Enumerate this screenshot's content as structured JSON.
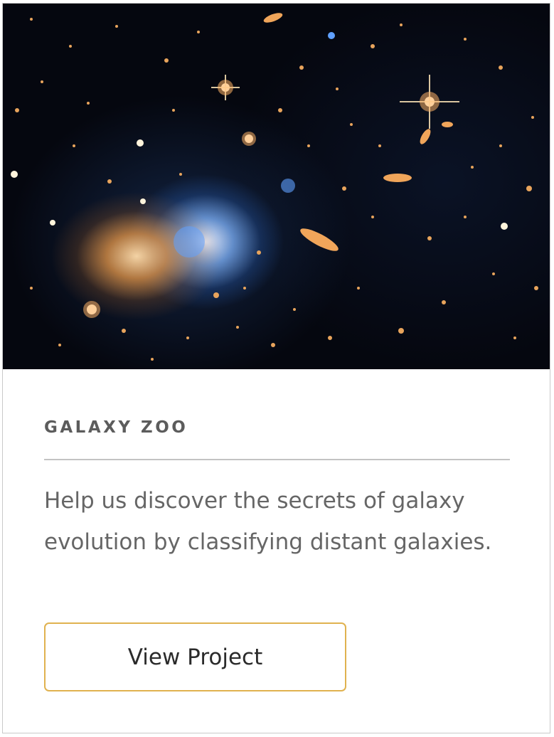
{
  "card": {
    "image_alt": "Galaxy cluster image",
    "title": "GALAXY ZOO",
    "description": "Help us discover the secrets of galaxy evolution by classifying distant galaxies.",
    "button_label": "View Project"
  },
  "colors": {
    "button_border": "#e0b24f",
    "title_text": "#5c5c5c",
    "body_text": "#666666",
    "divider": "#c3c3c3",
    "card_border": "#c9c9c9"
  }
}
